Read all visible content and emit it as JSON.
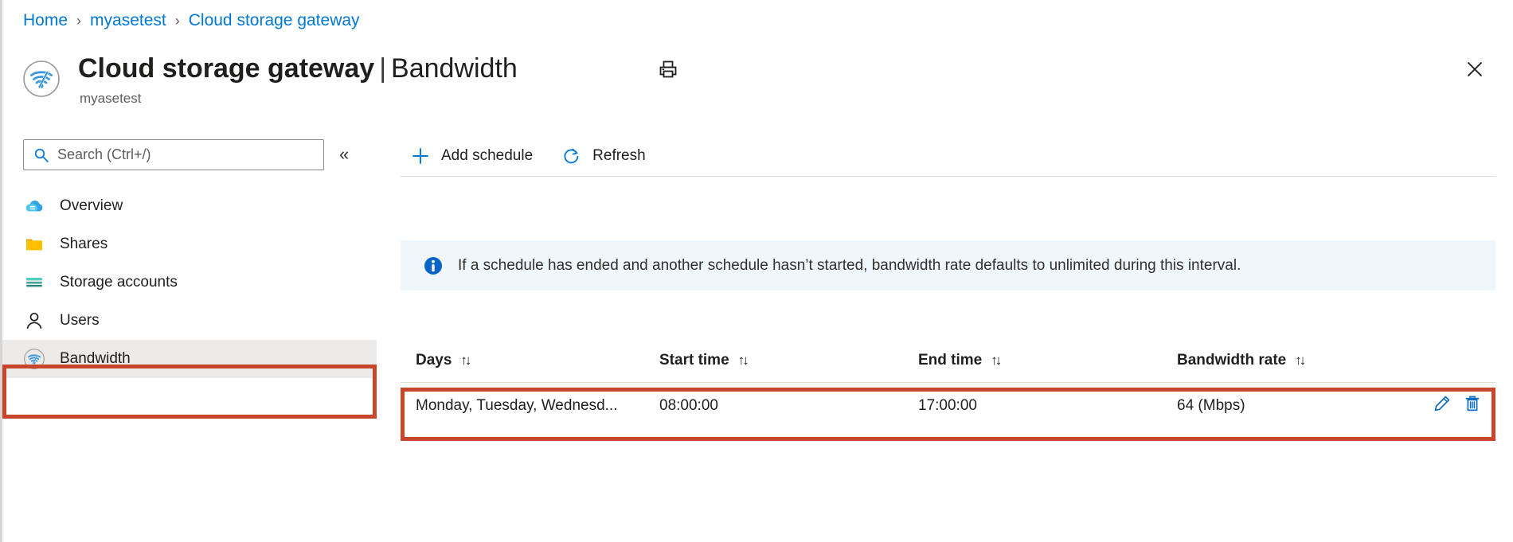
{
  "breadcrumb": {
    "items": [
      {
        "label": "Home"
      },
      {
        "label": "myasetest"
      },
      {
        "label": "Cloud storage gateway"
      }
    ],
    "separator": "›"
  },
  "header": {
    "title": "Cloud storage gateway",
    "title_separator": "|",
    "title_section": "Bandwidth",
    "subtitle": "myasetest",
    "resource_icon": "cloud-storage-gateway-icon",
    "print_icon": "print-icon",
    "close_icon": "close-icon"
  },
  "sidebar": {
    "search": {
      "placeholder": "Search (Ctrl+/)",
      "value": "",
      "icon": "search-icon"
    },
    "collapse_label": "«",
    "items": [
      {
        "label": "Overview",
        "icon": "cloud-icon",
        "selected": false
      },
      {
        "label": "Shares",
        "icon": "folder-icon",
        "selected": false
      },
      {
        "label": "Storage accounts",
        "icon": "storage-account-icon",
        "selected": false
      },
      {
        "label": "Users",
        "icon": "user-icon",
        "selected": false
      },
      {
        "label": "Bandwidth",
        "icon": "bandwidth-icon",
        "selected": true
      }
    ]
  },
  "toolbar": {
    "add_schedule_label": "Add schedule",
    "add_schedule_icon": "plus-icon",
    "refresh_label": "Refresh",
    "refresh_icon": "refresh-icon"
  },
  "info_banner": {
    "icon": "info-icon",
    "message": "If a schedule has ended and another schedule hasn’t started, bandwidth rate defaults to unlimited during this interval."
  },
  "table": {
    "sort_glyph": "↑↓",
    "columns": [
      {
        "label": "Days",
        "key": "days"
      },
      {
        "label": "Start time",
        "key": "start"
      },
      {
        "label": "End time",
        "key": "end"
      },
      {
        "label": "Bandwidth rate",
        "key": "rate"
      }
    ],
    "rows": [
      {
        "days": "Monday, Tuesday, Wednesd...",
        "start": "08:00:00",
        "end": "17:00:00",
        "rate": "64 (Mbps)",
        "edit_icon": "pencil-icon",
        "delete_icon": "trash-icon"
      }
    ]
  },
  "annotations": {
    "highlight_color": "#c8472c",
    "boxes": [
      {
        "name": "bandwidth-nav-highlight"
      },
      {
        "name": "schedule-row-highlight"
      }
    ]
  },
  "colors": {
    "link": "#0078d4",
    "accent": "#0078d4",
    "info_bg": "#eff6fc",
    "selected_bg": "#edebe9"
  }
}
